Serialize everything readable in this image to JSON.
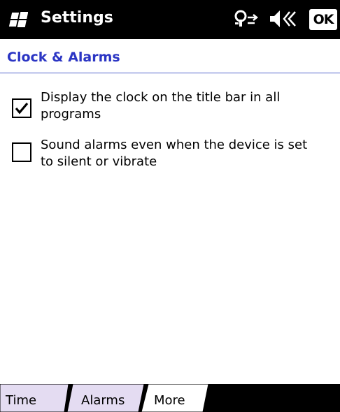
{
  "window": {
    "title": "Settings",
    "ok_label": "OK",
    "status_icons": [
      "connectivity-icon",
      "volume-icon"
    ]
  },
  "page": {
    "title": "Clock & Alarms"
  },
  "options": [
    {
      "label": "Display the clock on the title bar in all programs",
      "checked": true
    },
    {
      "label": "Sound alarms even when the device is set to silent or vibrate",
      "checked": false
    }
  ],
  "tabs": [
    {
      "label": "Time",
      "selected": false
    },
    {
      "label": "Alarms",
      "selected": false
    },
    {
      "label": "More",
      "selected": true
    }
  ],
  "colors": {
    "title_bar": "#000000",
    "page_title": "#2b35c4",
    "header_rule": "#5566cc",
    "tab_inactive": "#e4dcf2",
    "tab_active": "#ffffff"
  }
}
